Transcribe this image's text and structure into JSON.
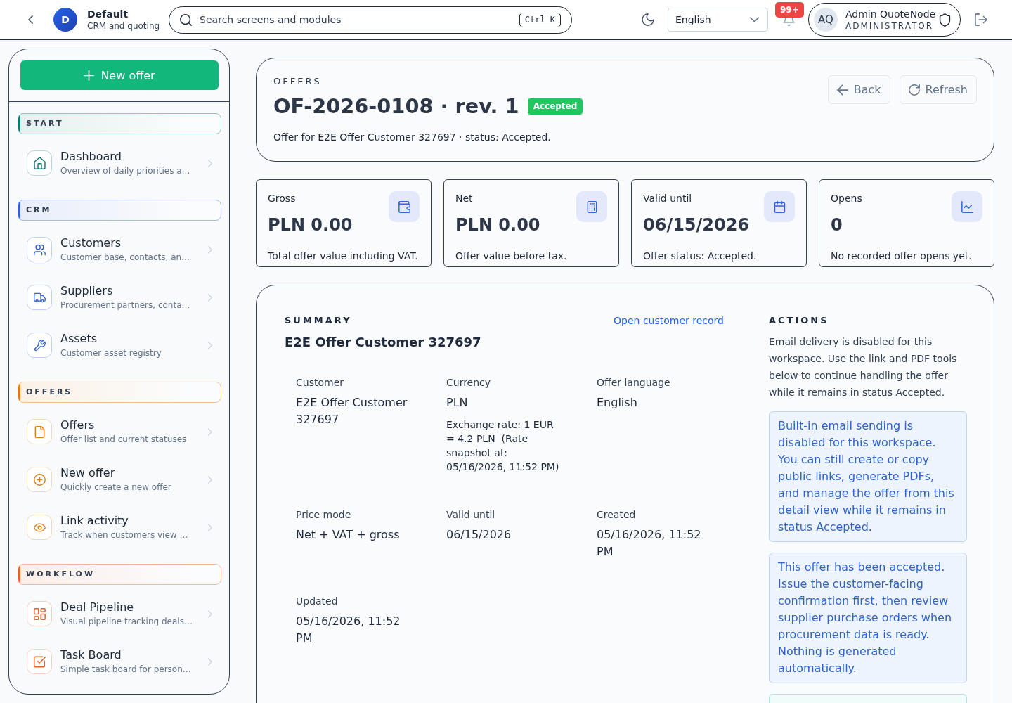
{
  "top_bar": {
    "workspace": {
      "initial": "D",
      "name": "Default",
      "subtitle": "CRM and quoting"
    },
    "search": {
      "placeholder": "Search screens and modules",
      "shortcut": "Ctrl K"
    },
    "language": "English",
    "notifications": {
      "count": "99+"
    },
    "user": {
      "initials": "AQ",
      "name": "Admin QuoteNode",
      "role": "ADMINISTRATOR"
    }
  },
  "sidebar": {
    "primary_button": "New offer",
    "sections": [
      {
        "title": "START",
        "color": "#0f766e",
        "items": [
          {
            "label": "Dashboard",
            "description": "Overview of daily priorities a…",
            "selected": false
          }
        ]
      },
      {
        "title": "CRM",
        "color": "#2f5fd3",
        "items": [
          {
            "label": "Customers",
            "description": "Customer base, contacts, an…",
            "selected": false
          },
          {
            "label": "Suppliers",
            "description": "Procurement partners, conta…",
            "selected": false
          },
          {
            "label": "Assets",
            "description": "Customer asset registry",
            "selected": false
          }
        ]
      },
      {
        "title": "OFFERS",
        "color": "#dc7c16",
        "items": [
          {
            "label": "Offers",
            "description": "Offer list and current statuses",
            "selected": false
          },
          {
            "label": "New offer",
            "description": "Quickly create a new offer",
            "selected": false
          },
          {
            "label": "Link activity",
            "description": "Track when customers view …",
            "selected": false
          }
        ]
      },
      {
        "title": "WORKFLOW",
        "color": "#e0622a",
        "items": [
          {
            "label": "Deal Pipeline",
            "description": "Visual pipeline tracking deals…",
            "selected": false
          },
          {
            "label": "Task Board",
            "description": "Simple task board for person…",
            "selected": false
          }
        ]
      }
    ]
  },
  "header": {
    "eyebrow": "OFFERS",
    "title": "OF-2026-0108 · rev. 1",
    "status": "Accepted",
    "subtitle": "Offer for E2E Offer Customer 327697 · status: Accepted.",
    "buttons": [
      "Back",
      "Refresh"
    ]
  },
  "stats": [
    {
      "label": "Gross",
      "value": "PLN 0.00",
      "caption": "Total offer value including VAT."
    },
    {
      "label": "Net",
      "value": "PLN 0.00",
      "caption": "Offer value before tax."
    },
    {
      "label": "Valid until",
      "value": "06/15/2026",
      "caption": "Offer status: Accepted."
    },
    {
      "label": "Opens",
      "value": "0",
      "caption": "No recorded offer opens yet."
    }
  ],
  "summary": {
    "heading": "SUMMARY",
    "link": "Open customer record",
    "title": "E2E Offer Customer 327697",
    "fields": [
      {
        "label": "Customer",
        "value": "E2E Offer Customer 327697"
      },
      {
        "label": "Currency",
        "value": "PLN",
        "note": "Exchange rate: 1 EUR = 4.2 PLN  (Rate snapshot at: 05/16/2026, 11:52 PM)"
      },
      {
        "label": "Offer language",
        "value": "English"
      },
      {
        "label": "Price mode",
        "value": "Net + VAT + gross"
      },
      {
        "label": "Valid until",
        "value": "06/15/2026"
      },
      {
        "label": "Created",
        "value": "05/16/2026, 11:52 PM"
      },
      {
        "label": "Updated",
        "value": "05/16/2026, 11:52 PM"
      }
    ]
  },
  "actions": {
    "heading": "ACTIONS",
    "text": "Email delivery is disabled for this workspace. Use the link and PDF tools below to continue handling the offer while it remains in status Accepted.",
    "notices": [
      {
        "kind": "info",
        "text": "Built-in email sending is disabled for this workspace. You can still create or copy public links, generate PDFs, and manage the offer from this detail view while it remains in status Accepted."
      },
      {
        "kind": "info",
        "text": "This offer has been accepted. Issue the customer-facing confirmation first, then review supplier purchase orders when procurement data is ready. Nothing is generated automatically."
      },
      {
        "kind": "success"
      }
    ]
  }
}
